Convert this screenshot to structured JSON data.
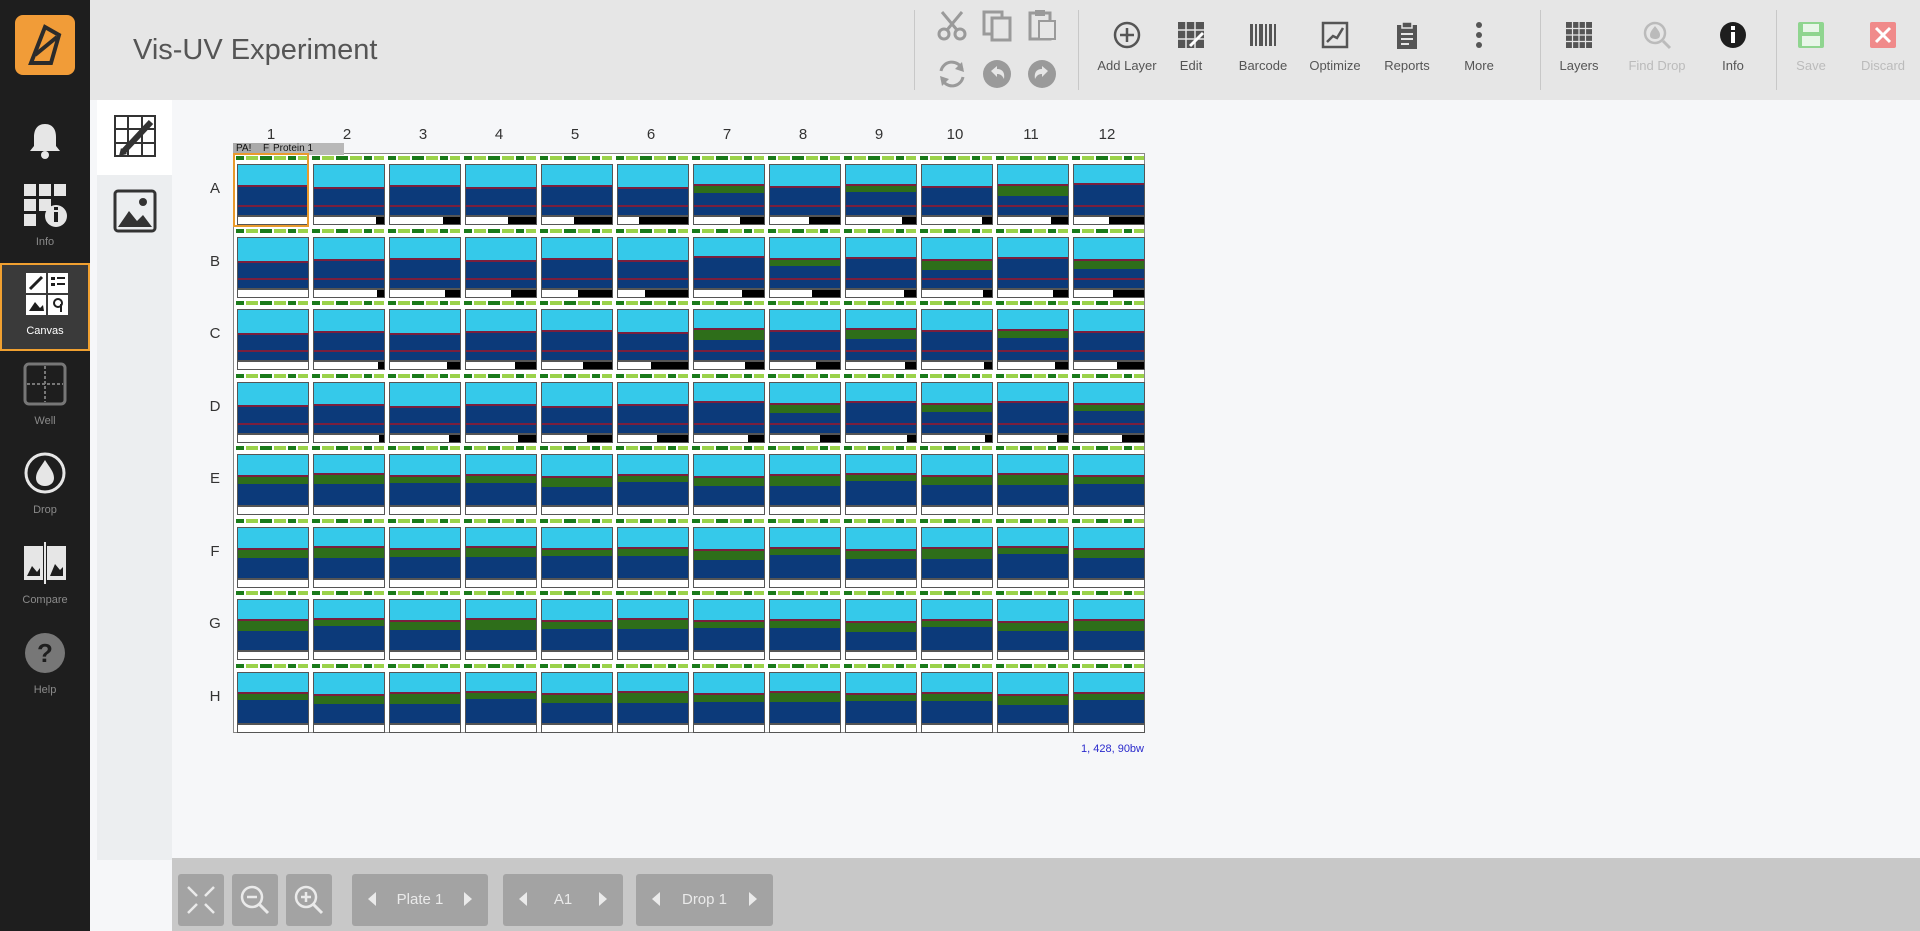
{
  "app": {
    "title": "Vis-UV Experiment"
  },
  "nav": {
    "items": [
      {
        "key": "notifications",
        "label": ""
      },
      {
        "key": "info",
        "label": "Info"
      },
      {
        "key": "canvas",
        "label": "Canvas"
      },
      {
        "key": "well",
        "label": "Well"
      },
      {
        "key": "drop",
        "label": "Drop"
      },
      {
        "key": "compare",
        "label": "Compare"
      },
      {
        "key": "help",
        "label": "Help"
      }
    ]
  },
  "toolbar": {
    "add_layer": "Add Layer",
    "edit": "Edit",
    "barcode": "Barcode",
    "optimize": "Optimize",
    "reports": "Reports",
    "more": "More",
    "layers": "Layers",
    "find_drop": "Find Drop",
    "info": "Info",
    "save": "Save",
    "discard": "Discard"
  },
  "plate": {
    "columns": [
      "1",
      "2",
      "3",
      "4",
      "5",
      "6",
      "7",
      "8",
      "9",
      "10",
      "11",
      "12"
    ],
    "rows": [
      "A",
      "B",
      "C",
      "D",
      "E",
      "F",
      "G",
      "H"
    ],
    "layer_tags": [
      "PA!",
      "F",
      "Protein 1"
    ],
    "selected_well": "A1",
    "coords_readout": "1, 428, 90bw",
    "colors": {
      "sky": "#35c9ea",
      "deep": "#0c3a7a",
      "green_band": "#2e6e1a",
      "maroon_band": "#7a1f3d",
      "bar_dark": "#1a7a1a",
      "bar_light": "#9ad24a",
      "selection": "#e99a2c"
    }
  },
  "footer": {
    "plate_label": "Plate 1",
    "well_label": "A1",
    "drop_label": "Drop 1"
  }
}
